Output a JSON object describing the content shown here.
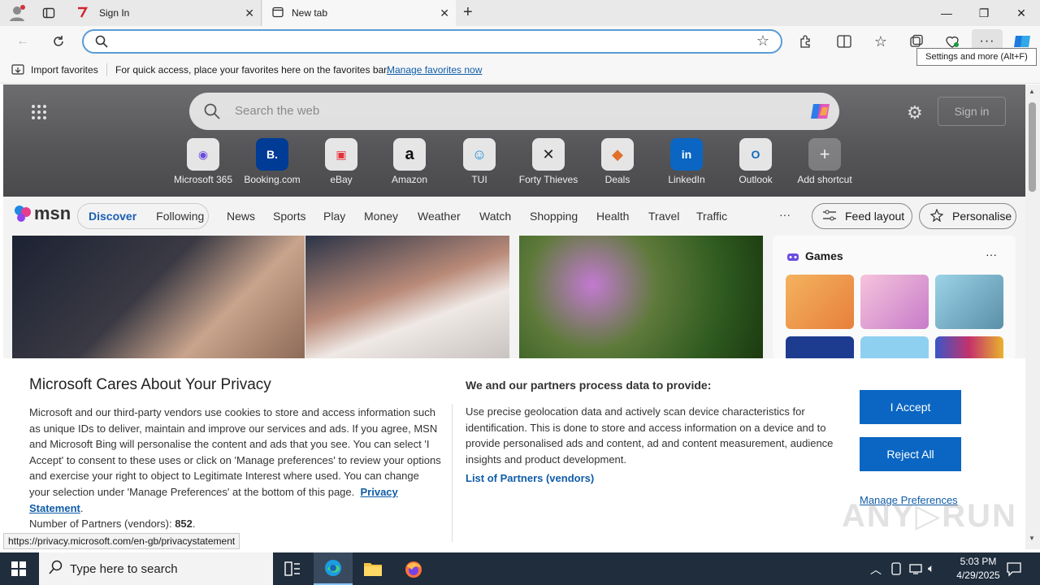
{
  "tabs": [
    {
      "title": "Sign In"
    },
    {
      "title": "New tab"
    }
  ],
  "toolbar": {
    "address_value": "",
    "tooltip": "Settings and more (Alt+F)"
  },
  "favorites_bar": {
    "import_label": "Import favorites",
    "hint": "For quick access, place your favorites here on the favorites bar.",
    "manage_link": "Manage favorites now"
  },
  "msn": {
    "search_placeholder": "Search the web",
    "sign_in": "Sign in",
    "shortcuts": [
      {
        "label": "Microsoft 365",
        "glyph": "◉"
      },
      {
        "label": "Booking.com",
        "glyph": "B."
      },
      {
        "label": "eBay",
        "glyph": "▣"
      },
      {
        "label": "Amazon",
        "glyph": "a"
      },
      {
        "label": "TUI",
        "glyph": "☺"
      },
      {
        "label": "Forty Thieves",
        "glyph": "✕"
      },
      {
        "label": "Deals",
        "glyph": "◆"
      },
      {
        "label": "LinkedIn",
        "glyph": "in"
      },
      {
        "label": "Outlook",
        "glyph": "O"
      },
      {
        "label": "Add shortcut",
        "glyph": "+"
      }
    ],
    "logo": "msn",
    "nav": {
      "discover": "Discover",
      "following": "Following",
      "links": [
        "News",
        "Sports",
        "Play",
        "Money",
        "Weather",
        "Watch",
        "Shopping",
        "Health",
        "Travel",
        "Traffic"
      ],
      "more": "···",
      "feed_layout": "Feed layout",
      "personalise": "Personalise"
    },
    "games": {
      "title": "Games",
      "more": "···"
    }
  },
  "privacy": {
    "title": "Microsoft Cares About Your Privacy",
    "body": "Microsoft and our third-party vendors use cookies to store and access information such as unique IDs to deliver, maintain and improve our services and ads. If you agree, MSN and Microsoft Bing will personalise the content and ads that you see. You can select 'I Accept' to consent to these uses or click on 'Manage preferences' to review your options and exercise your right to object to Legitimate Interest where used.  You can change your selection under 'Manage Preferences' at the bottom of this page.",
    "privacy_link": "Privacy Statement",
    "partners_label": "Number of Partners (vendors):",
    "partners_count": "852",
    "right_title": "We and our partners process data to provide:",
    "right_body": "Use precise geolocation data and actively scan device characteristics for identification. This is done to store and access information on a device and to provide personalised ads and content, ad and content measurement, audience insights and product development.",
    "vendors_link": "List of Partners (vendors)",
    "accept": "I Accept",
    "reject": "Reject All",
    "manage": "Manage Preferences"
  },
  "status_url": "https://privacy.microsoft.com/en-gb/privacystatement",
  "taskbar": {
    "search_placeholder": "Type here to search",
    "time": "5:03 PM",
    "date": "4/29/2025"
  },
  "colors": {
    "accent_blue": "#0a66c2",
    "link_blue": "#0f5ca8",
    "discover_blue": "#1a5fb4",
    "taskbar": "#1f2d3d"
  }
}
